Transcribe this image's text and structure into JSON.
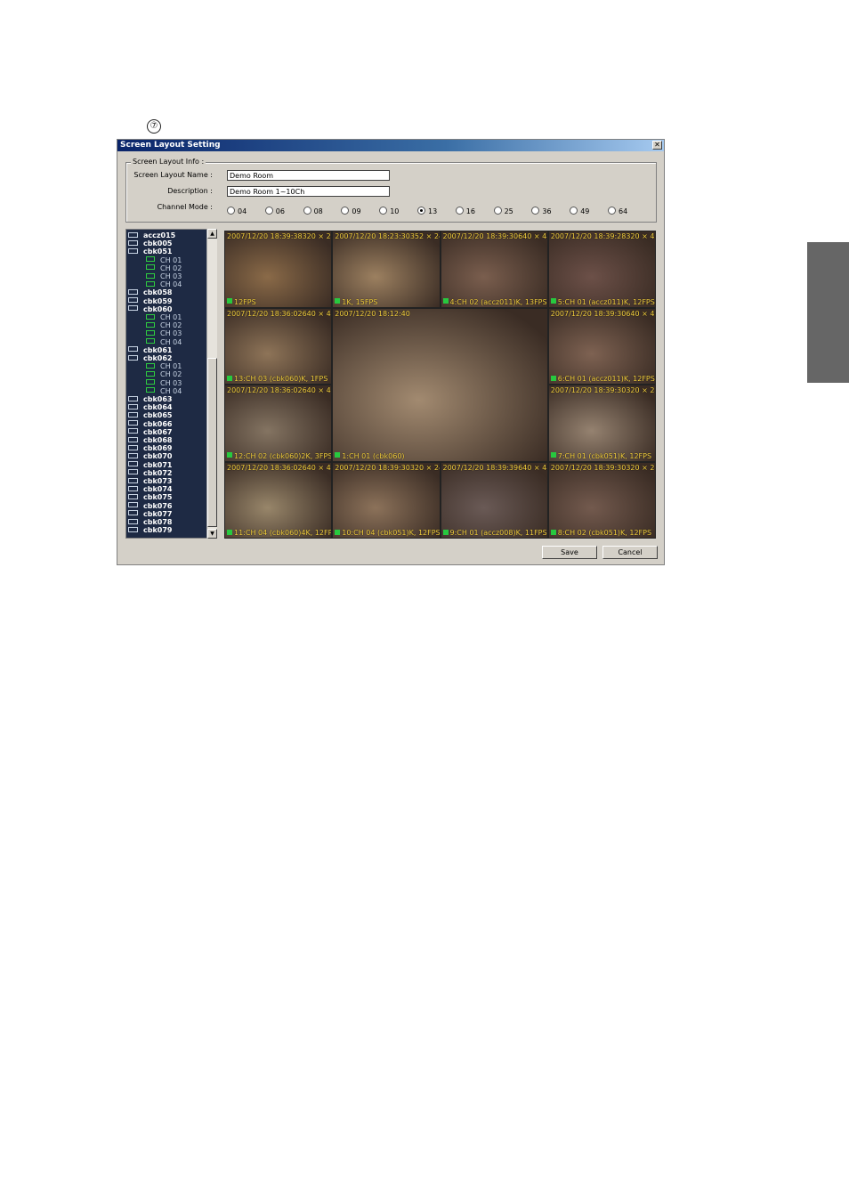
{
  "step_marker": "⑦",
  "window": {
    "title": "Screen Layout Setting",
    "close_symbol": "✕"
  },
  "info": {
    "legend": "Screen Layout Info :",
    "name_label": "Screen Layout Name :",
    "name_value": "Demo Room",
    "desc_label": "Description :",
    "desc_value": "Demo Room 1~10Ch",
    "mode_label": "Channel Mode :",
    "modes": [
      "04",
      "06",
      "08",
      "09",
      "10",
      "13",
      "16",
      "25",
      "36",
      "49",
      "64"
    ],
    "selected_mode": "13"
  },
  "tree": [
    {
      "label": "accz015",
      "type": "node"
    },
    {
      "label": "cbk005",
      "type": "node"
    },
    {
      "label": "cbk051",
      "type": "node"
    },
    {
      "label": "CH 01",
      "type": "child"
    },
    {
      "label": "CH 02",
      "type": "child"
    },
    {
      "label": "CH 03",
      "type": "child"
    },
    {
      "label": "CH 04",
      "type": "child"
    },
    {
      "label": "cbk058",
      "type": "node"
    },
    {
      "label": "cbk059",
      "type": "node"
    },
    {
      "label": "cbk060",
      "type": "node"
    },
    {
      "label": "CH 01",
      "type": "child"
    },
    {
      "label": "CH 02",
      "type": "child"
    },
    {
      "label": "CH 03",
      "type": "child"
    },
    {
      "label": "CH 04",
      "type": "child"
    },
    {
      "label": "cbk061",
      "type": "node"
    },
    {
      "label": "cbk062",
      "type": "node"
    },
    {
      "label": "CH 01",
      "type": "child"
    },
    {
      "label": "CH 02",
      "type": "child"
    },
    {
      "label": "CH 03",
      "type": "child"
    },
    {
      "label": "CH 04",
      "type": "child"
    },
    {
      "label": "cbk063",
      "type": "node"
    },
    {
      "label": "cbk064",
      "type": "node"
    },
    {
      "label": "cbk065",
      "type": "node"
    },
    {
      "label": "cbk066",
      "type": "node"
    },
    {
      "label": "cbk067",
      "type": "node"
    },
    {
      "label": "cbk068",
      "type": "node"
    },
    {
      "label": "cbk069",
      "type": "node"
    },
    {
      "label": "cbk070",
      "type": "node"
    },
    {
      "label": "cbk071",
      "type": "node"
    },
    {
      "label": "cbk072",
      "type": "node"
    },
    {
      "label": "cbk073",
      "type": "node"
    },
    {
      "label": "cbk074",
      "type": "node"
    },
    {
      "label": "cbk075",
      "type": "node"
    },
    {
      "label": "cbk076",
      "type": "node"
    },
    {
      "label": "cbk077",
      "type": "node"
    },
    {
      "label": "cbk078",
      "type": "node"
    },
    {
      "label": "cbk079",
      "type": "node"
    }
  ],
  "scroll": {
    "up_symbol": "▲",
    "down_symbol": "▼"
  },
  "cameras": [
    {
      "ts": "2007/12/20 18:39:38320 × 240",
      "info": "12FPS",
      "color": "#8a6a48"
    },
    {
      "ts": "2007/12/20 18:23:30352 × 240",
      "info": "1K, 15FPS",
      "color": "#9c8060"
    },
    {
      "ts": "2007/12/20 18:39:30640 × 480",
      "info": "4:CH 02 (accz011)K, 13FPS",
      "color": "#7a5e4e"
    },
    {
      "ts": "2007/12/20 18:39:28320 × 480",
      "info": "5:CH 01 (accz011)K, 12FPS",
      "color": "#6c5048"
    },
    {
      "ts": "2007/12/20 18:36:02640 × 480",
      "info": "13:CH 03 (cbk060)K, 1FPS",
      "color": "#8e7458"
    },
    {
      "ts": "2007/12/20 18:12:40",
      "info": "1:CH 01 (cbk060)",
      "color": "#a28a70"
    },
    {
      "ts": "2007/12/20 18:39:30640 × 480",
      "info": "6:CH 01 (accz011)K, 12FPS",
      "color": "#7e6252"
    },
    {
      "ts": "2007/12/20 18:36:02640 × 480",
      "info": "12:CH 02 (cbk060)2K, 3FPS",
      "color": "#847462"
    },
    {
      "ts": "2007/12/20 18:39:30320 × 240",
      "info": "7:CH 01 (cbk051)K, 12FPS",
      "color": "#958270"
    },
    {
      "ts": "2007/12/20 18:36:02640 × 480",
      "info": "11:CH 04 (cbk060)4K, 12FPS",
      "color": "#98866a"
    },
    {
      "ts": "2007/12/20 18:39:30320 × 240",
      "info": "10:CH 04 (cbk051)K, 12FPS",
      "color": "#8c725a"
    },
    {
      "ts": "2007/12/20 18:39:39640 × 480",
      "info": "9:CH 01 (accz008)K, 11FPS",
      "color": "#6a5a56"
    },
    {
      "ts": "2007/12/20 18:39:30320 × 240",
      "info": "8:CH 02 (cbk051)K, 12FPS",
      "color": "#735a4e"
    }
  ],
  "buttons": {
    "save": "Save",
    "cancel": "Cancel"
  }
}
